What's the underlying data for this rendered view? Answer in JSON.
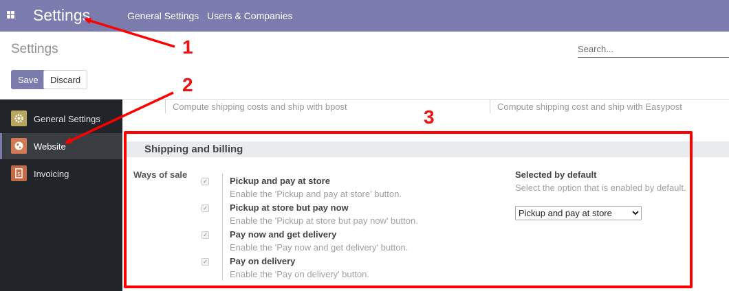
{
  "topbar": {
    "apps_icon": "apps-grid-icon",
    "brand": "Settings",
    "menu": [
      "General Settings",
      "Users & Companies"
    ]
  },
  "control_panel": {
    "title": "Settings",
    "search_placeholder": "Search...",
    "save_label": "Save",
    "discard_label": "Discard"
  },
  "sidebar": {
    "items": [
      {
        "label": "General Settings",
        "icon": "gear-icon",
        "color": "#b8a65f",
        "active": false
      },
      {
        "label": "Website",
        "icon": "globe-icon",
        "color": "#d07a55",
        "active": true
      },
      {
        "label": "Invoicing",
        "icon": "invoice-icon",
        "color": "#c26b45",
        "active": false
      }
    ]
  },
  "content": {
    "prev_left": "Compute shipping costs and ship with bpost",
    "prev_right": "Compute shipping cost and ship with Easypost",
    "section_title": "Shipping and billing",
    "ways_label": "Ways of sale",
    "options": [
      {
        "title": "Pickup and pay at store",
        "desc": "Enable the 'Pickup and pay at store' button.",
        "checked": true
      },
      {
        "title": "Pickup at store but pay now",
        "desc": "Enable the 'Pickup at store but pay now' button.",
        "checked": true
      },
      {
        "title": "Pay now and get delivery",
        "desc": "Enable the 'Pay now and get delivery' button.",
        "checked": true
      },
      {
        "title": "Pay on delivery",
        "desc": "Enable the 'Pay on delivery' button.",
        "checked": true
      }
    ],
    "default_title": "Selected by default",
    "default_desc": "Select the option that is enabled by default.",
    "default_value": "Pickup and pay at store"
  },
  "annotations": {
    "labels": [
      "1",
      "2",
      "3"
    ],
    "color": "#ff0000"
  },
  "colors": {
    "navbar": "#7c7bad",
    "sidebar": "#212529",
    "section_header": "#e9ecef"
  }
}
